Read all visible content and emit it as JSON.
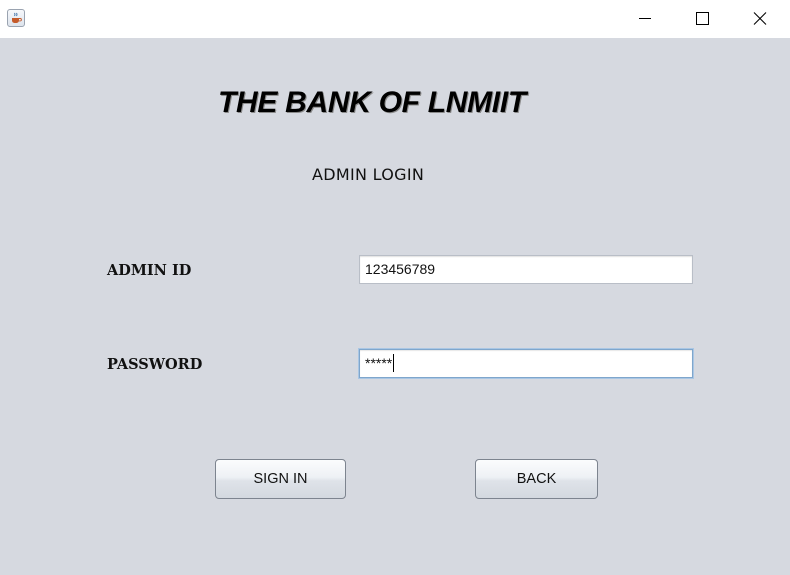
{
  "window": {
    "app_icon": "java-cup-icon",
    "controls": {
      "minimize_icon": "minimize-icon",
      "maximize_icon": "maximize-icon",
      "close_icon": "close-icon"
    }
  },
  "header": {
    "title": "THE BANK OF LNMIIT",
    "subtitle": "ADMIN LOGIN"
  },
  "form": {
    "admin_id": {
      "label": "ADMIN ID",
      "value": "123456789"
    },
    "password": {
      "label": "PASSWORD",
      "value": "*****"
    }
  },
  "buttons": {
    "sign_in": "SIGN IN",
    "back": "BACK"
  },
  "colors": {
    "background": "#d6d9e0",
    "titlebar": "#ffffff",
    "focus_border": "#7fa6cc"
  }
}
